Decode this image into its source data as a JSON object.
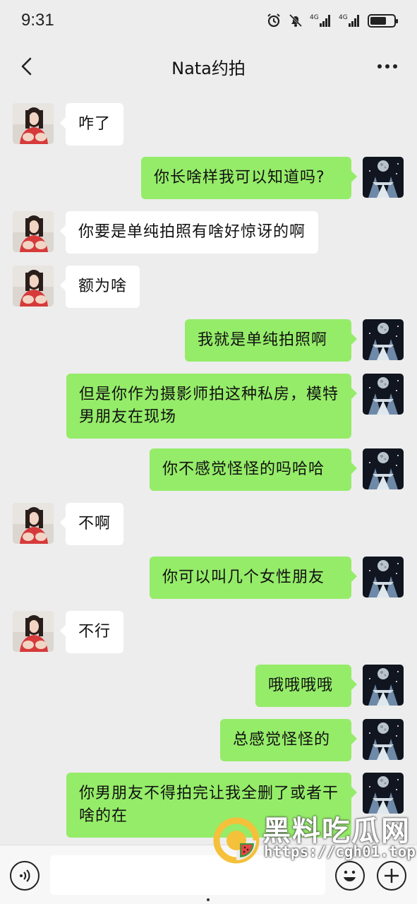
{
  "status_bar": {
    "time": "9:31",
    "icons": [
      "alarm-icon",
      "mute-icon",
      "signal-4g-icon",
      "signal-4g-icon",
      "battery-icon"
    ],
    "network_label_1": "4G",
    "network_label_2": "4G"
  },
  "header": {
    "title": "Nata约拍",
    "back_icon": "chevron-left-icon",
    "more_icon": "more-dots-icon"
  },
  "messages": [
    {
      "side": "in",
      "text": "咋了"
    },
    {
      "side": "out",
      "text": "你长啥样我可以知道吗?"
    },
    {
      "side": "in",
      "text": "你要是单纯拍照有啥好惊讶的啊"
    },
    {
      "side": "in",
      "text": "额为啥"
    },
    {
      "side": "out",
      "text": "我就是单纯拍照啊"
    },
    {
      "side": "out",
      "text": "但是你作为摄影师拍这种私房，模特男朋友在现场"
    },
    {
      "side": "out",
      "text": "你不感觉怪怪的吗哈哈"
    },
    {
      "side": "in",
      "text": "不啊"
    },
    {
      "side": "out",
      "text": "你可以叫几个女性朋友"
    },
    {
      "side": "in",
      "text": "不行"
    },
    {
      "side": "out",
      "text": "哦哦哦哦"
    },
    {
      "side": "out",
      "text": "总感觉怪怪的"
    },
    {
      "side": "out",
      "text": "你男朋友不得拍完让我全删了或者干啥的在"
    }
  ],
  "input_bar": {
    "voice_icon": "voice-icon",
    "input_value": "",
    "emoji_icon": "emoji-icon",
    "plus_icon": "plus-icon"
  },
  "watermark": {
    "name": "黑料吃瓜网",
    "url": "https://cgh01.top"
  },
  "colors": {
    "background": "#ededed",
    "outgoing_bubble": "#95ec69",
    "incoming_bubble": "#ffffff",
    "input_bar": "#f7f7f7"
  }
}
